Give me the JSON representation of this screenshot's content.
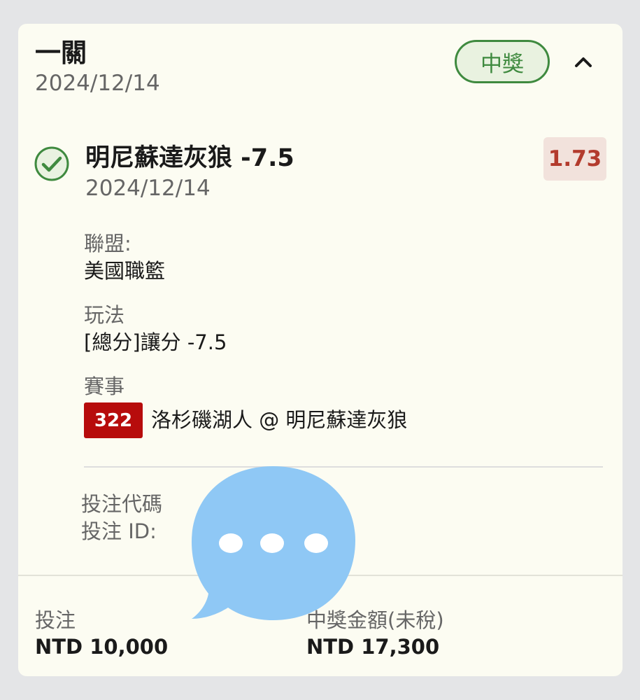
{
  "header": {
    "bet_type": "一關",
    "date": "2024/12/14",
    "status_badge": "中獎"
  },
  "selection": {
    "name": "明尼蘇達灰狼 -7.5",
    "date": "2024/12/14",
    "odds": "1.73"
  },
  "details": {
    "league_label": "聯盟:",
    "league_value": "美國職籃",
    "market_label": "玩法",
    "market_value": "[總分]讓分 -7.5",
    "event_label": "賽事",
    "event_number": "322",
    "event_name": "洛杉磯湖人 @ 明尼蘇達灰狼"
  },
  "codes": {
    "bet_code_label": "投注代碼",
    "bet_id_label": "投注 ID:"
  },
  "footer": {
    "stake_label": "投注",
    "stake_value": "NTD 10,000",
    "payout_label": "中獎金額(未稅)",
    "payout_value": "NTD 17,300"
  },
  "icons": {
    "status": "check-circle-icon",
    "collapse": "chevron-up-icon",
    "overlay": "speech-bubble-icon"
  },
  "colors": {
    "win_green": "#3f8a3f",
    "odds_red": "#b33b2d",
    "event_badge_red": "#b70c0c",
    "bubble_blue": "#8fc8f5"
  }
}
